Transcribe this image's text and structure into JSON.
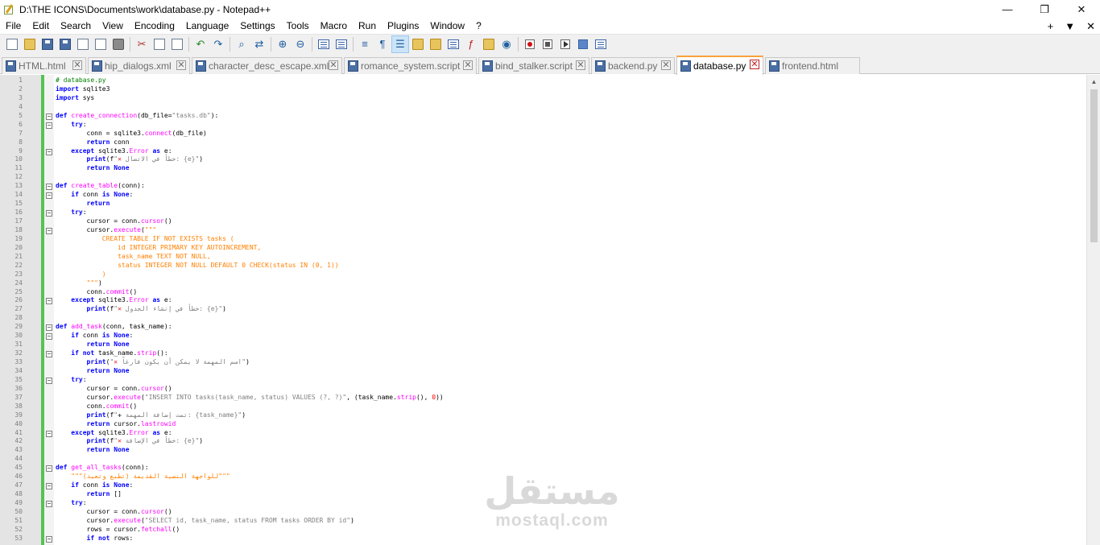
{
  "window": {
    "title": "D:\\THE ICONS\\Documents\\work\\database.py - Notepad++",
    "minimize": "—",
    "restore": "❐",
    "close": "✕"
  },
  "menu": {
    "items": [
      "File",
      "Edit",
      "Search",
      "View",
      "Encoding",
      "Language",
      "Settings",
      "Tools",
      "Macro",
      "Run",
      "Plugins",
      "Window",
      "?"
    ],
    "right": [
      "+",
      "▼",
      "✕"
    ]
  },
  "tabs": [
    {
      "label": "HTML.html",
      "active": false
    },
    {
      "label": "hip_dialogs.xml",
      "active": false
    },
    {
      "label": "character_desc_escape.xml",
      "active": false
    },
    {
      "label": "romance_system.script",
      "active": false
    },
    {
      "label": "bind_stalker.script",
      "active": false
    },
    {
      "label": "backend.py",
      "active": false
    },
    {
      "label": "database.py",
      "active": true
    },
    {
      "label": "frontend.html",
      "active": false
    }
  ],
  "tab_close_glyph": "✕",
  "code_lines": [
    {
      "n": "1",
      "f": "",
      "h": "<span class=\"cmt\"># database.py</span>"
    },
    {
      "n": "2",
      "f": "",
      "h": "<span class=\"kw\">import</span> sqlite3"
    },
    {
      "n": "3",
      "f": "",
      "h": "<span class=\"kw\">import</span> sys"
    },
    {
      "n": "4",
      "f": "",
      "h": ""
    },
    {
      "n": "5",
      "f": "−",
      "h": "<span class=\"kw\">def</span> <span class=\"fn\">create_connection</span>(db_file=<span class=\"str\">\"tasks.db\"</span>):"
    },
    {
      "n": "6",
      "f": "−",
      "h": "    <span class=\"kw\">try</span>:"
    },
    {
      "n": "7",
      "f": "",
      "h": "        conn = sqlite3.<span class=\"fn\">connect</span>(db_file)"
    },
    {
      "n": "8",
      "f": "",
      "h": "        <span class=\"kw\">return</span> conn"
    },
    {
      "n": "9",
      "f": "−",
      "h": "    <span class=\"kw\">except</span> sqlite3.<span class=\"fn\">Error</span> <span class=\"kw\">as</span> e:"
    },
    {
      "n": "10",
      "f": "",
      "h": "        <span class=\"kw\">print</span>(f<span class=\"str\">\"<span class=\"xmark\">✕</span> خطأ في الاتصال: {e}\"</span>)"
    },
    {
      "n": "11",
      "f": "",
      "h": "        <span class=\"kw\">return</span> <span class=\"kw\">None</span>"
    },
    {
      "n": "12",
      "f": "",
      "h": ""
    },
    {
      "n": "13",
      "f": "−",
      "h": "<span class=\"kw\">def</span> <span class=\"fn\">create_table</span>(conn):"
    },
    {
      "n": "14",
      "f": "−",
      "h": "    <span class=\"kw\">if</span> conn <span class=\"kw\">is</span> <span class=\"kw\">None</span>:"
    },
    {
      "n": "15",
      "f": "",
      "h": "        <span class=\"kw\">return</span>"
    },
    {
      "n": "16",
      "f": "−",
      "h": "    <span class=\"kw\">try</span>:"
    },
    {
      "n": "17",
      "f": "",
      "h": "        cursor = conn.<span class=\"fn\">cursor</span>()"
    },
    {
      "n": "18",
      "f": "−",
      "h": "        cursor.<span class=\"fn\">execute</span>(<span class=\"tri\">\"\"\"</span>"
    },
    {
      "n": "19",
      "f": "",
      "h": "<span class=\"tri\">            CREATE TABLE IF NOT EXISTS tasks (</span>"
    },
    {
      "n": "20",
      "f": "",
      "h": "<span class=\"tri\">                id INTEGER PRIMARY KEY AUTOINCREMENT,</span>"
    },
    {
      "n": "21",
      "f": "",
      "h": "<span class=\"tri\">                task_name TEXT NOT NULL,</span>"
    },
    {
      "n": "22",
      "f": "",
      "h": "<span class=\"tri\">                status INTEGER NOT NULL DEFAULT 0 CHECK(status IN (0, 1))</span>"
    },
    {
      "n": "23",
      "f": "",
      "h": "<span class=\"tri\">            )</span>"
    },
    {
      "n": "24",
      "f": "",
      "h": "<span class=\"tri\">        \"\"\"</span>)"
    },
    {
      "n": "25",
      "f": "",
      "h": "        conn.<span class=\"fn\">commit</span>()"
    },
    {
      "n": "26",
      "f": "−",
      "h": "    <span class=\"kw\">except</span> sqlite3.<span class=\"fn\">Error</span> <span class=\"kw\">as</span> e:"
    },
    {
      "n": "27",
      "f": "",
      "h": "        <span class=\"kw\">print</span>(f<span class=\"str\">\"<span class=\"xmark\">✕</span> خطأ في إنشاء الجدول: {e}\"</span>)"
    },
    {
      "n": "28",
      "f": "",
      "h": ""
    },
    {
      "n": "29",
      "f": "−",
      "h": "<span class=\"kw\">def</span> <span class=\"fn\">add_task</span>(conn, task_name):"
    },
    {
      "n": "30",
      "f": "−",
      "h": "    <span class=\"kw\">if</span> conn <span class=\"kw\">is</span> <span class=\"kw\">None</span>:"
    },
    {
      "n": "31",
      "f": "",
      "h": "        <span class=\"kw\">return</span> <span class=\"kw\">None</span>"
    },
    {
      "n": "32",
      "f": "−",
      "h": "    <span class=\"kw\">if</span> <span class=\"kw\">not</span> task_name.<span class=\"fn\">strip</span>():"
    },
    {
      "n": "33",
      "f": "",
      "h": "        <span class=\"kw\">print</span>(<span class=\"str\">\"<span class=\"xmark\">✕</span> اسم المهمة لا يمكن أن يكون فارغاً\"</span>)"
    },
    {
      "n": "34",
      "f": "",
      "h": "        <span class=\"kw\">return</span> <span class=\"kw\">None</span>"
    },
    {
      "n": "35",
      "f": "−",
      "h": "    <span class=\"kw\">try</span>:"
    },
    {
      "n": "36",
      "f": "",
      "h": "        cursor = conn.<span class=\"fn\">cursor</span>()"
    },
    {
      "n": "37",
      "f": "",
      "h": "        cursor.<span class=\"fn\">execute</span>(<span class=\"str\">\"INSERT INTO tasks(task_name, status) VALUES (?, ?)\"</span>, (task_name.<span class=\"fn\">strip</span>(), <span class=\"num\">0</span>))"
    },
    {
      "n": "38",
      "f": "",
      "h": "        conn.<span class=\"fn\">commit</span>()"
    },
    {
      "n": "39",
      "f": "",
      "h": "        <span class=\"kw\">print</span>(f<span class=\"str\">\"<span class=\"plus\">✚</span> تمت إضافة المهمة: {task_name}\"</span>)"
    },
    {
      "n": "40",
      "f": "",
      "h": "        <span class=\"kw\">return</span> cursor.<span class=\"fn\">lastrowid</span>"
    },
    {
      "n": "41",
      "f": "−",
      "h": "    <span class=\"kw\">except</span> sqlite3.<span class=\"fn\">Error</span> <span class=\"kw\">as</span> e:"
    },
    {
      "n": "42",
      "f": "",
      "h": "        <span class=\"kw\">print</span>(f<span class=\"str\">\"<span class=\"xmark\">✕</span> خطأ في الإضافة: {e}\"</span>)"
    },
    {
      "n": "43",
      "f": "",
      "h": "        <span class=\"kw\">return</span> <span class=\"kw\">None</span>"
    },
    {
      "n": "44",
      "f": "",
      "h": ""
    },
    {
      "n": "45",
      "f": "−",
      "h": "<span class=\"kw\">def</span> <span class=\"fn\">get_all_tasks</span>(conn):"
    },
    {
      "n": "46",
      "f": "",
      "h": "    <span class=\"tri\">\"\"\"للواجهة النصية القديمة (تطبع وتعيد)\"\"\"</span>"
    },
    {
      "n": "47",
      "f": "−",
      "h": "    <span class=\"kw\">if</span> conn <span class=\"kw\">is</span> <span class=\"kw\">None</span>:"
    },
    {
      "n": "48",
      "f": "",
      "h": "        <span class=\"kw\">return</span> []"
    },
    {
      "n": "49",
      "f": "−",
      "h": "    <span class=\"kw\">try</span>:"
    },
    {
      "n": "50",
      "f": "",
      "h": "        cursor = conn.<span class=\"fn\">cursor</span>()"
    },
    {
      "n": "51",
      "f": "",
      "h": "        cursor.<span class=\"fn\">execute</span>(<span class=\"str\">\"SELECT id, task_name, status FROM tasks ORDER BY id\"</span>)"
    },
    {
      "n": "52",
      "f": "",
      "h": "        rows = cursor.<span class=\"fn\">fetchall</span>()"
    },
    {
      "n": "53",
      "f": "−",
      "h": "        <span class=\"kw\">if</span> <span class=\"kw\">not</span> rows:"
    }
  ],
  "watermark": {
    "arabic": "مستقل",
    "latin": "mostaql.com"
  },
  "colors": {
    "accent_tab": "#f9a23c",
    "change_bar": "#55c255",
    "keyword": "#0000ff",
    "function": "#ff00ff"
  }
}
